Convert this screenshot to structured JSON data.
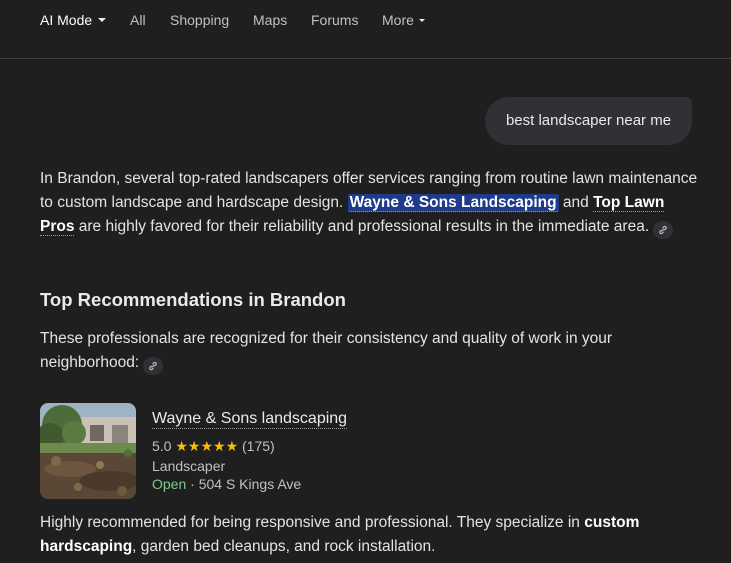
{
  "nav": {
    "tabs": [
      {
        "label": "AI Mode",
        "active": true
      },
      {
        "label": "All"
      },
      {
        "label": "Shopping"
      },
      {
        "label": "Maps"
      },
      {
        "label": "Forums"
      },
      {
        "label": "More"
      }
    ]
  },
  "query": "best landscaper near me",
  "answer": {
    "intro_1": "In Brandon, several top-rated landscapers offer services ranging from routine lawn maintenance to custom landscape and hardscape design. ",
    "highlight_1": "Wayne & Sons Landscaping",
    "intro_2": " and ",
    "highlight_2": "Top Lawn Pros",
    "intro_3": " are highly favored for their reliability and professional results in the immediate area."
  },
  "section": {
    "heading": "Top Recommendations in Brandon",
    "description": "These professionals are recognized for their consistency and quality of work in your neighborhood:"
  },
  "business": {
    "name": "Wayne & Sons landscaping",
    "rating": "5.0",
    "stars": "★★★★★",
    "reviews": "(175)",
    "category": "Landscaper",
    "status": "Open",
    "separator": " · ",
    "address": "504 S Kings Ave",
    "summary_1": "Highly recommended for being responsive and professional. They specialize in ",
    "summary_bold_1": "custom hardscaping",
    "summary_2": ", garden bed cleanups, and rock installation."
  },
  "icons": {
    "source_link": "link-icon",
    "dropdown": "chevron-down-icon"
  },
  "colors": {
    "background": "#1f1f1f",
    "highlight": "#1e3a8a",
    "stars": "#fbbc04",
    "open": "#81c995"
  }
}
